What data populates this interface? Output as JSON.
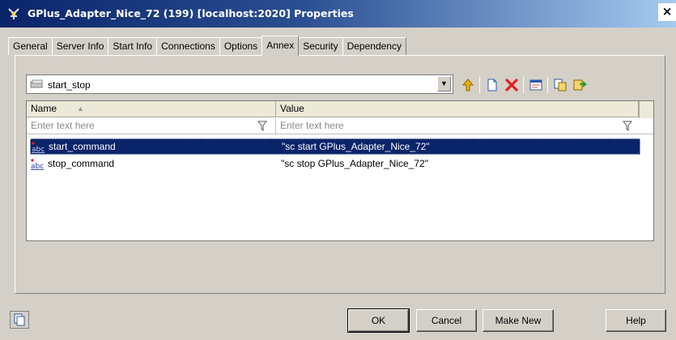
{
  "window": {
    "title": "GPlus_Adapter_Nice_72 (199) [localhost:2020] Properties",
    "title_icon": "plugin-icon",
    "close_label": "×"
  },
  "tabs": [
    {
      "label": "General"
    },
    {
      "label": "Server Info"
    },
    {
      "label": "Start Info"
    },
    {
      "label": "Connections"
    },
    {
      "label": "Options"
    },
    {
      "label": "Annex",
      "active": true
    },
    {
      "label": "Security"
    },
    {
      "label": "Dependency"
    }
  ],
  "section_combo": {
    "value": "start_stop",
    "icon": "section-icon"
  },
  "toolbar": {
    "icons": [
      "move-up-icon",
      "new-icon",
      "delete-icon",
      "properties-icon",
      "copy-icon",
      "paste-icon"
    ]
  },
  "grid": {
    "columns": [
      "Name",
      "Value"
    ],
    "filter_placeholder": "Enter text here",
    "rows": [
      {
        "name": "start_command",
        "value": "\"sc start GPlus_Adapter_Nice_72\"",
        "selected": true
      },
      {
        "name": "stop_command",
        "value": "\"sc stop GPlus_Adapter_Nice_72\"",
        "selected": false
      }
    ]
  },
  "buttons": {
    "ok": "OK",
    "cancel": "Cancel",
    "make_new": "Make New",
    "help": "Help"
  },
  "colors": {
    "selection": "#0a246a",
    "title_start": "#0a246a",
    "title_end": "#a6caf0"
  }
}
